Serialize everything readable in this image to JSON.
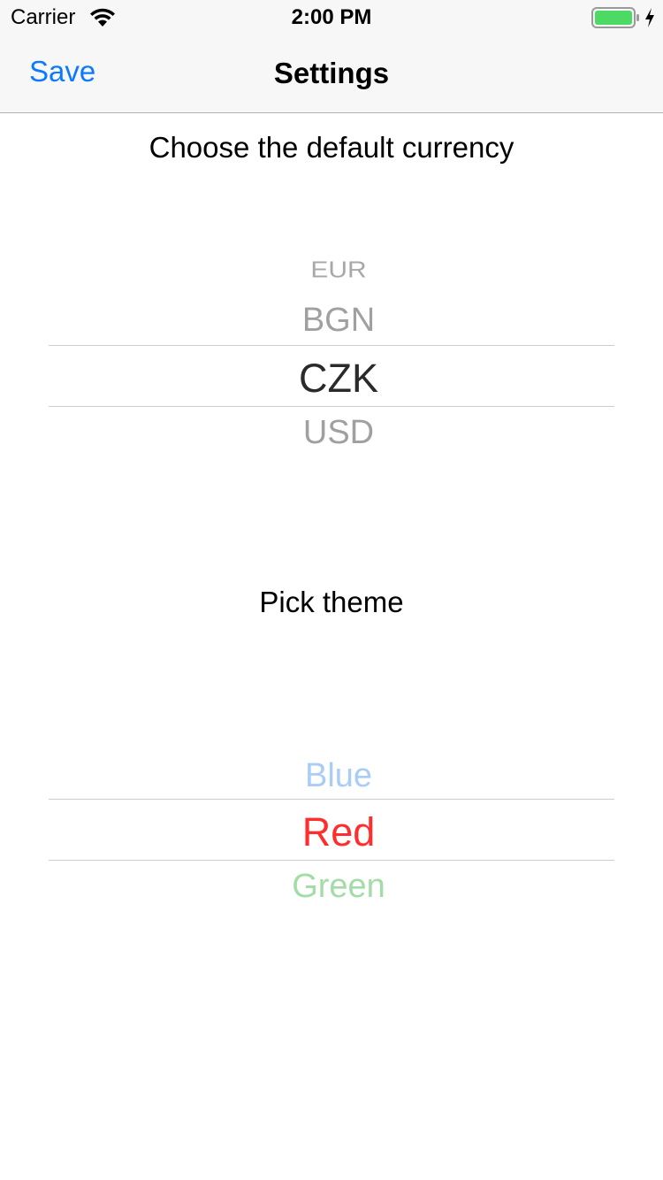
{
  "status_bar": {
    "carrier": "Carrier",
    "time": "2:00 PM",
    "icons": [
      "wifi-icon",
      "battery-icon",
      "charging-bolt-icon"
    ],
    "battery_color": "#4cd964"
  },
  "nav": {
    "left_button": "Save",
    "title": "Settings",
    "accent": "#0a7aff"
  },
  "currency": {
    "label": "Choose the default currency",
    "options": [
      "EUR",
      "BGN",
      "CZK",
      "USD"
    ],
    "selected": "CZK"
  },
  "theme": {
    "label": "Pick theme",
    "options": [
      {
        "name": "Blue",
        "color": "#a9cdf6"
      },
      {
        "name": "Red",
        "color": "#ff2d2d"
      },
      {
        "name": "Green",
        "color": "#a3dca6"
      }
    ],
    "selected": "Red"
  }
}
